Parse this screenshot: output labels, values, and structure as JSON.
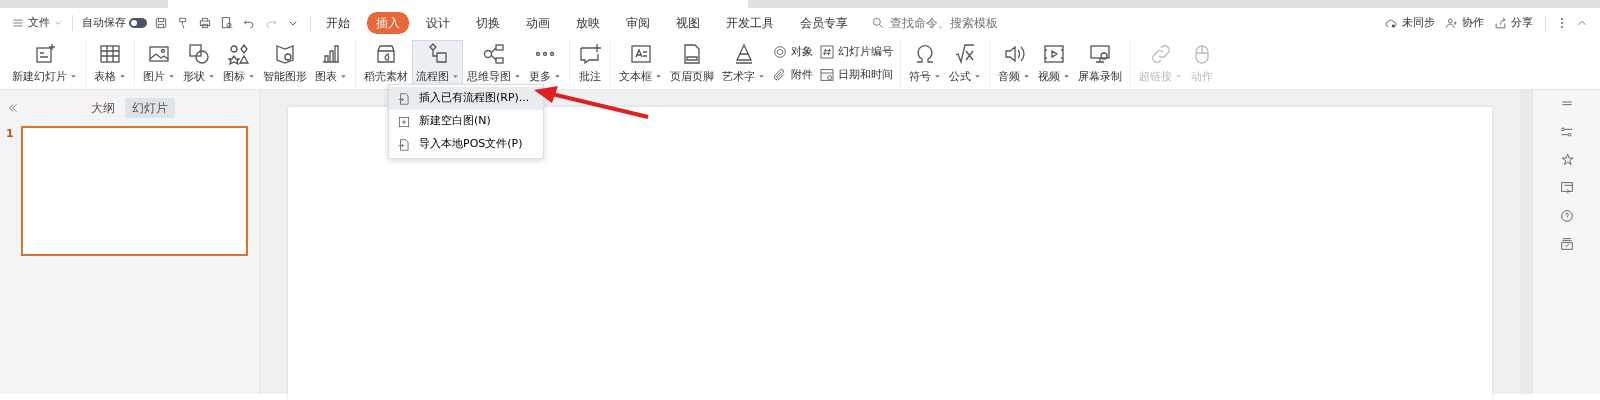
{
  "menu_bar": {
    "file_menu": {
      "label": "文件"
    },
    "autosave": {
      "label": "自动保存",
      "on": false
    },
    "tabs": [
      {
        "label": "开始",
        "selected": false
      },
      {
        "label": "插入",
        "selected": true
      },
      {
        "label": "设计",
        "selected": false
      },
      {
        "label": "切换",
        "selected": false
      },
      {
        "label": "动画",
        "selected": false
      },
      {
        "label": "放映",
        "selected": false
      },
      {
        "label": "审阅",
        "selected": false
      },
      {
        "label": "视图",
        "selected": false
      },
      {
        "label": "开发工具",
        "selected": false
      },
      {
        "label": "会员专享",
        "selected": false
      }
    ],
    "search": {
      "placeholder": "查找命令、搜索模板"
    },
    "actions": [
      {
        "label": "未同步"
      },
      {
        "label": "协作"
      },
      {
        "label": "分享"
      }
    ]
  },
  "ribbon": {
    "groups": [
      [
        {
          "kind": "large",
          "items": [
            {
              "label": "新建幻灯片",
              "dropdown": true,
              "selected": false,
              "disabled": false
            }
          ]
        }
      ],
      [
        {
          "kind": "large",
          "items": [
            {
              "label": "表格",
              "dropdown": true,
              "selected": false,
              "disabled": false
            }
          ]
        }
      ],
      [
        {
          "kind": "large",
          "items": [
            {
              "label": "图片",
              "dropdown": true,
              "selected": false,
              "disabled": false
            }
          ]
        },
        {
          "kind": "large",
          "items": [
            {
              "label": "形状",
              "dropdown": true,
              "selected": false,
              "disabled": false
            }
          ]
        },
        {
          "kind": "large",
          "items": [
            {
              "label": "图标",
              "dropdown": true,
              "selected": false,
              "disabled": false
            }
          ]
        },
        {
          "kind": "large",
          "items": [
            {
              "label": "智能图形",
              "dropdown": false,
              "selected": false,
              "disabled": false
            }
          ]
        },
        {
          "kind": "large",
          "items": [
            {
              "label": "图表",
              "dropdown": true,
              "selected": false,
              "disabled": false
            }
          ]
        }
      ],
      [
        {
          "kind": "large",
          "items": [
            {
              "label": "稻壳素材",
              "dropdown": false,
              "selected": false,
              "disabled": false
            }
          ]
        },
        {
          "kind": "large",
          "items": [
            {
              "label": "流程图",
              "dropdown": true,
              "selected": true,
              "disabled": false
            }
          ]
        },
        {
          "kind": "large",
          "items": [
            {
              "label": "思维导图",
              "dropdown": true,
              "selected": false,
              "disabled": false
            }
          ]
        },
        {
          "kind": "large",
          "items": [
            {
              "label": "更多",
              "dropdown": true,
              "selected": false,
              "disabled": false
            }
          ]
        }
      ],
      [
        {
          "kind": "large",
          "items": [
            {
              "label": "批注",
              "dropdown": false,
              "selected": false,
              "disabled": false
            }
          ]
        }
      ],
      [
        {
          "kind": "large",
          "items": [
            {
              "label": "文本框",
              "dropdown": true,
              "selected": false,
              "disabled": false
            }
          ]
        },
        {
          "kind": "large",
          "items": [
            {
              "label": "页眉页脚",
              "dropdown": false,
              "selected": false,
              "disabled": false
            }
          ]
        },
        {
          "kind": "large",
          "items": [
            {
              "label": "艺术字",
              "dropdown": true,
              "selected": false,
              "disabled": false
            }
          ]
        },
        {
          "kind": "small",
          "items": [
            {
              "label": "对象",
              "dropdown": false,
              "selected": false,
              "disabled": false
            },
            {
              "label": "附件",
              "dropdown": false,
              "selected": false,
              "disabled": false
            }
          ]
        },
        {
          "kind": "small",
          "items": [
            {
              "label": "幻灯片编号",
              "dropdown": false,
              "selected": false,
              "disabled": false
            },
            {
              "label": "日期和时间",
              "dropdown": false,
              "selected": false,
              "disabled": false
            }
          ]
        }
      ],
      [
        {
          "kind": "large",
          "items": [
            {
              "label": "符号",
              "dropdown": true,
              "selected": false,
              "disabled": false
            }
          ]
        },
        {
          "kind": "large",
          "items": [
            {
              "label": "公式",
              "dropdown": true,
              "selected": false,
              "disabled": false
            }
          ]
        }
      ],
      [
        {
          "kind": "large",
          "items": [
            {
              "label": "音频",
              "dropdown": true,
              "selected": false,
              "disabled": false
            }
          ]
        },
        {
          "kind": "large",
          "items": [
            {
              "label": "视频",
              "dropdown": true,
              "selected": false,
              "disabled": false
            }
          ]
        },
        {
          "kind": "large",
          "items": [
            {
              "label": "屏幕录制",
              "dropdown": false,
              "selected": false,
              "disabled": false
            }
          ]
        }
      ],
      [
        {
          "kind": "large",
          "items": [
            {
              "label": "超链接",
              "dropdown": true,
              "selected": false,
              "disabled": true
            }
          ]
        },
        {
          "kind": "large",
          "items": [
            {
              "label": "动作",
              "dropdown": false,
              "selected": false,
              "disabled": true
            }
          ]
        }
      ]
    ]
  },
  "flowchart_menu": [
    {
      "label": "插入已有流程图(RP)...",
      "selected": true
    },
    {
      "label": "新建空白图(N)",
      "selected": false
    },
    {
      "label": "导入本地POS文件(P)",
      "selected": false
    }
  ],
  "side_panel": {
    "tabs": [
      {
        "label": "大纲",
        "selected": false
      },
      {
        "label": "幻灯片",
        "selected": true
      }
    ],
    "thumbnails": [
      {
        "number": "1",
        "selected": true
      }
    ]
  }
}
